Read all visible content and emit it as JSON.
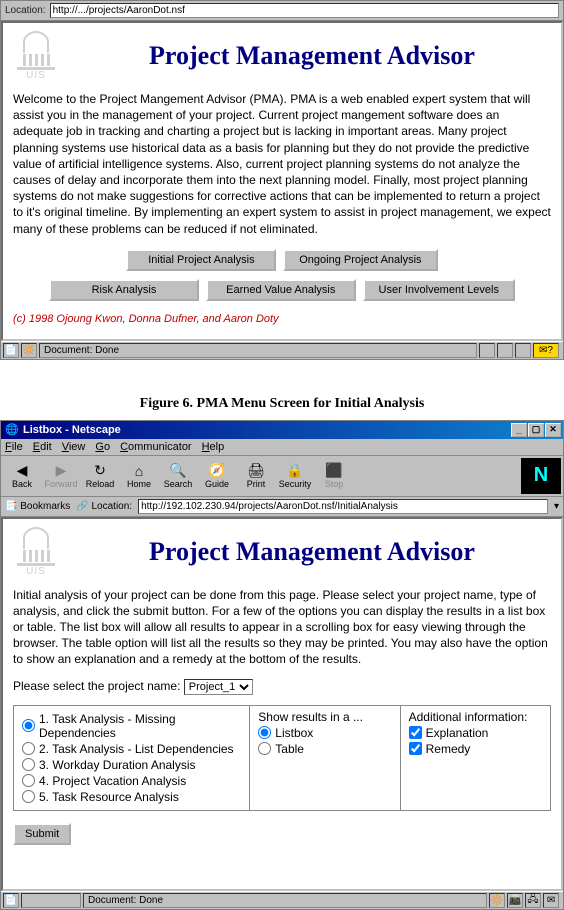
{
  "window1": {
    "location_label": "Location:",
    "location_value": "http://.../projects/AaronDot.nsf",
    "logo_text": "UIS",
    "title": "Project Management Advisor",
    "welcome": "Welcome to the Project Mangement Advisor (PMA). PMA is a web enabled expert system that will assist you in the management of your project. Current project mangement software does an adequate job in tracking and charting a project but is lacking in important areas. Many project planning systems use historical data as a basis for planning but they do not provide the predictive value of artificial intelligence systems. Also, current project planning systems do not analyze the causes of delay and incorporate them into the next planning model. Finally, most project planning systems do not make suggestions for corrective actions that can be implemented to return a project to it's original timeline. By implementing an expert system to assist in project management, we expect many of these problems can be reduced if not eliminated.",
    "buttons": {
      "initial": "Initial Project Analysis",
      "ongoing": "Ongoing Project Analysis",
      "risk": "Risk Analysis",
      "earned": "Earned Value Analysis",
      "user": "User Involvement Levels"
    },
    "copyright": "(c) 1998 Ojoung Kwon, Donna Dufner, and Aaron Doty",
    "status_text": "Document: Done"
  },
  "figure_caption": "Figure 6. PMA Menu Screen for Initial Analysis",
  "window2": {
    "titlebar": "Listbox - Netscape",
    "menus": [
      "File",
      "Edit",
      "View",
      "Go",
      "Communicator",
      "Help"
    ],
    "toolbar": {
      "back": "Back",
      "forward": "Forward",
      "reload": "Reload",
      "home": "Home",
      "search": "Search",
      "guide": "Guide",
      "print": "Print",
      "security": "Security",
      "stop": "Stop"
    },
    "bookmarks_label": "Bookmarks",
    "location_label": "Location:",
    "location_value": "http://192.102.230.94/projects/AaronDot.nsf/InitialAnalysis",
    "logo_text": "UIS",
    "title": "Project Management Advisor",
    "intro": "Initial analysis of your project can be done from this page. Please select your project name, type of analysis, and click the submit button. For a few of the options you can display the results in a list box or table. The list box will allow all results to appear in a scrolling box for easy viewing through the browser. The table option will list all the results so they may be printed. You may also have the option to show an explanation and a remedy at the bottom of the results.",
    "select_label": "Please select the project name:",
    "select_value": "Project_1",
    "analysis_options": [
      "1. Task Analysis - Missing Dependencies",
      "2. Task Analysis - List Dependencies",
      "3. Workday Duration Analysis",
      "4. Project Vacation Analysis",
      "5. Task Resource Analysis"
    ],
    "results_header": "Show results in a ...",
    "results_options": [
      "Listbox",
      "Table"
    ],
    "addl_header": "Additional information:",
    "addl_options": [
      "Explanation",
      "Remedy"
    ],
    "submit_label": "Submit",
    "status_text": "Document: Done"
  },
  "taskbar": {
    "start": "",
    "tray_time": ""
  }
}
